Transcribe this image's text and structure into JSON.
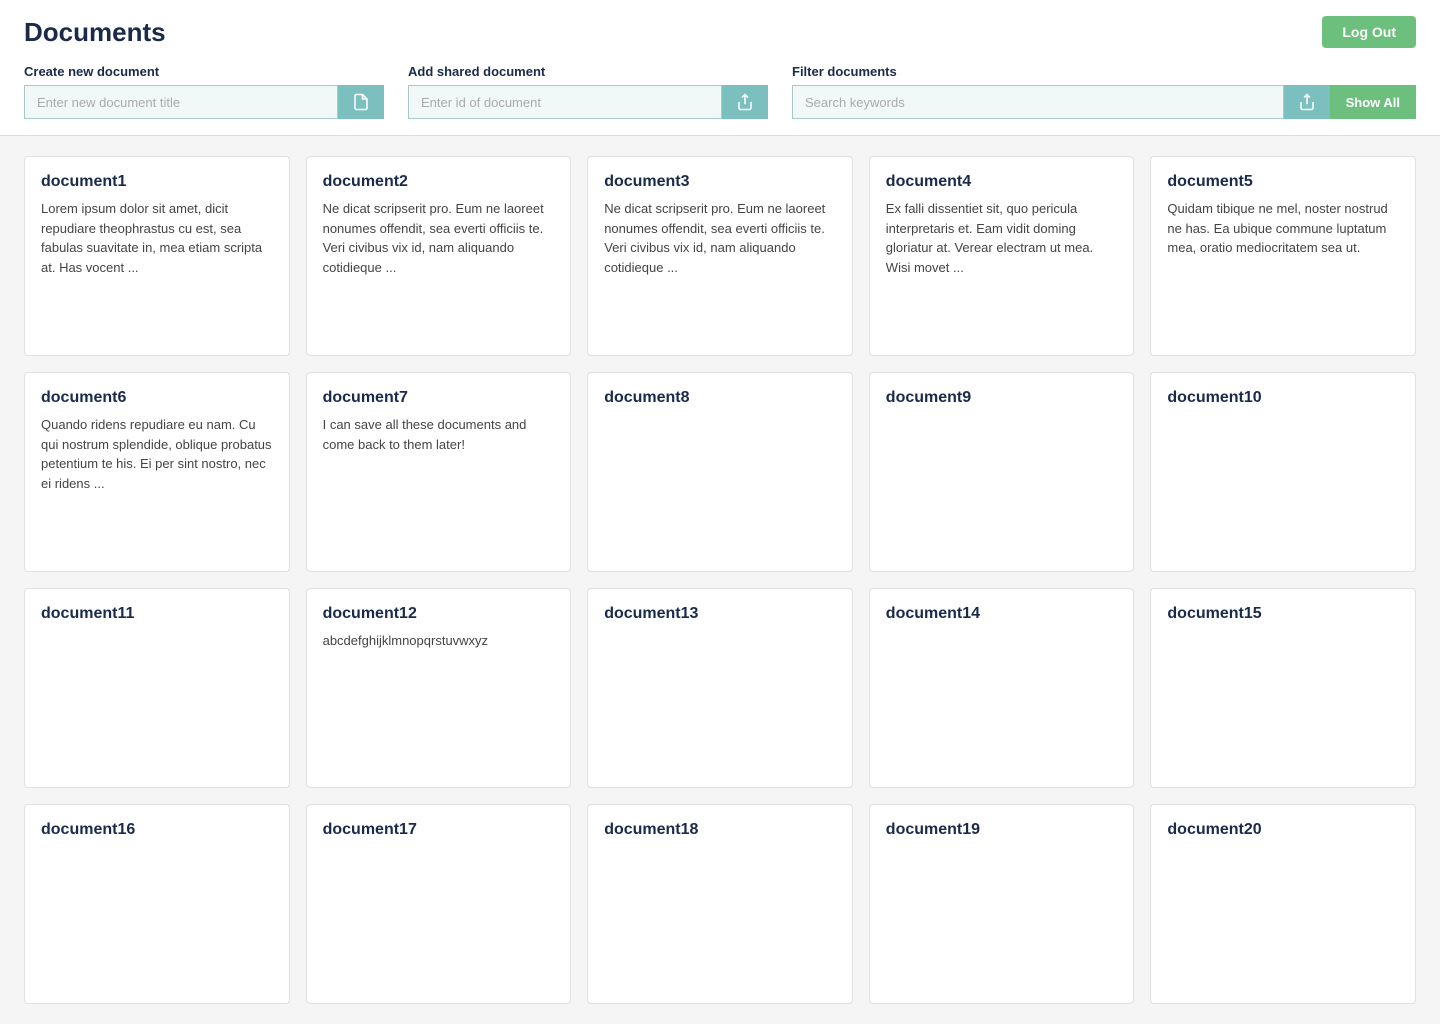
{
  "header": {
    "title": "Documents",
    "logout_label": "Log Out"
  },
  "toolbar": {
    "create": {
      "label": "Create new document",
      "placeholder": "Enter new document title",
      "button_icon": "📄"
    },
    "shared": {
      "label": "Add shared document",
      "placeholder": "Enter id of document",
      "button_icon": "↑"
    },
    "filter": {
      "label": "Filter documents",
      "placeholder": "Search keywords",
      "button_icon": "↑",
      "show_all_label": "Show All"
    }
  },
  "documents": [
    {
      "id": 1,
      "title": "document1",
      "body": "Lorem ipsum dolor sit amet, dicit repudiare theophrastus cu est, sea fabulas suavitate in, mea etiam scripta at. Has vocent ..."
    },
    {
      "id": 2,
      "title": "document2",
      "body": "Ne dicat scripserit pro. Eum ne laoreet nonumes offendit, sea everti officiis te. Veri civibus vix id, nam aliquando cotidieque ..."
    },
    {
      "id": 3,
      "title": "document3",
      "body": "Ne dicat scripserit pro. Eum ne laoreet nonumes offendit, sea everti officiis te. Veri civibus vix id, nam aliquando cotidieque ..."
    },
    {
      "id": 4,
      "title": "document4",
      "body": "Ex falli dissentiet sit, quo pericula interpretaris et. Eam vidit doming gloriatur at. Verear electram ut mea. Wisi movet ..."
    },
    {
      "id": 5,
      "title": "document5",
      "body": "Quidam tibique ne mel, noster nostrud ne has. Ea ubique commune luptatum mea, oratio mediocritatem sea ut."
    },
    {
      "id": 6,
      "title": "document6",
      "body": "Quando ridens repudiare eu nam. Cu qui nostrum splendide, oblique probatus petentium te his. Ei per sint nostro, nec ei ridens ..."
    },
    {
      "id": 7,
      "title": "document7",
      "body": "I can save all these documents and come back to them later!"
    },
    {
      "id": 8,
      "title": "document8",
      "body": ""
    },
    {
      "id": 9,
      "title": "document9",
      "body": ""
    },
    {
      "id": 10,
      "title": "document10",
      "body": ""
    },
    {
      "id": 11,
      "title": "document11",
      "body": ""
    },
    {
      "id": 12,
      "title": "document12",
      "body": "abcdefghijklmnopqrstuvwxyz"
    },
    {
      "id": 13,
      "title": "document13",
      "body": ""
    },
    {
      "id": 14,
      "title": "document14",
      "body": ""
    },
    {
      "id": 15,
      "title": "document15",
      "body": ""
    },
    {
      "id": 16,
      "title": "document16",
      "body": ""
    },
    {
      "id": 17,
      "title": "document17",
      "body": ""
    },
    {
      "id": 18,
      "title": "document18",
      "body": ""
    },
    {
      "id": 19,
      "title": "document19",
      "body": ""
    },
    {
      "id": 20,
      "title": "document20",
      "body": ""
    }
  ]
}
